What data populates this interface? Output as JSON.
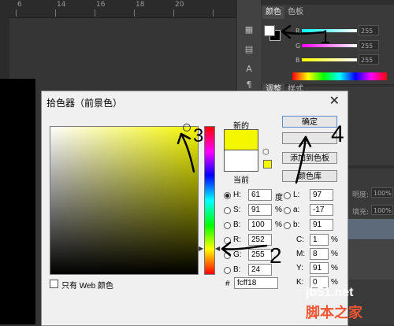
{
  "ruler": {
    "labels": [
      "6",
      "14",
      "16",
      "18",
      "20"
    ]
  },
  "panel": {
    "tab_color": "颜色",
    "tab_swatches": "色板",
    "channels": [
      {
        "label": "R",
        "value": "255"
      },
      {
        "label": "G",
        "value": "255"
      },
      {
        "label": "B",
        "value": "255"
      }
    ],
    "lower_tabs": [
      "调整",
      "样式"
    ],
    "opacity_label": "明度:",
    "opacity_value": "100%",
    "fill_label": "填充:",
    "fill_value": "100%",
    "tool_letters": [
      "A",
      "¶"
    ]
  },
  "dialog": {
    "title": "拾色器（前景色）",
    "close": "✕",
    "new_label": "新的",
    "current_label": "当前",
    "new_color": "#f5f700",
    "current_color": "#ffffff",
    "ok": "确定",
    "cancel": "",
    "add_swatches": "添加到色板",
    "color_libraries": "颜色库",
    "hsb": [
      {
        "label": "H:",
        "value": "61",
        "unit": "度",
        "selected": true
      },
      {
        "label": "S:",
        "value": "91",
        "unit": "%",
        "selected": false
      },
      {
        "label": "B:",
        "value": "100",
        "unit": "%",
        "selected": false
      }
    ],
    "rgb": [
      {
        "label": "R:",
        "value": "252"
      },
      {
        "label": "G:",
        "value": "255"
      },
      {
        "label": "B:",
        "value": "24"
      }
    ],
    "lab": [
      {
        "label": "L:",
        "value": "97"
      },
      {
        "label": "a:",
        "value": "-17"
      },
      {
        "label": "b:",
        "value": "91"
      }
    ],
    "cmyk": [
      {
        "label": "C:",
        "value": "1",
        "unit": "%"
      },
      {
        "label": "M:",
        "value": "8",
        "unit": "%"
      },
      {
        "label": "Y:",
        "value": "91",
        "unit": "%"
      },
      {
        "label": "K:",
        "value": "0",
        "unit": "%"
      }
    ],
    "hex_label": "#",
    "hex_value": "fcff18",
    "web_only": "只有 Web 颜色"
  },
  "annotations": {
    "n1": "1",
    "n2": "2",
    "n3": "3",
    "n4": "4"
  },
  "watermark": {
    "line1": "jb51.net",
    "line2": "脚本之家"
  }
}
